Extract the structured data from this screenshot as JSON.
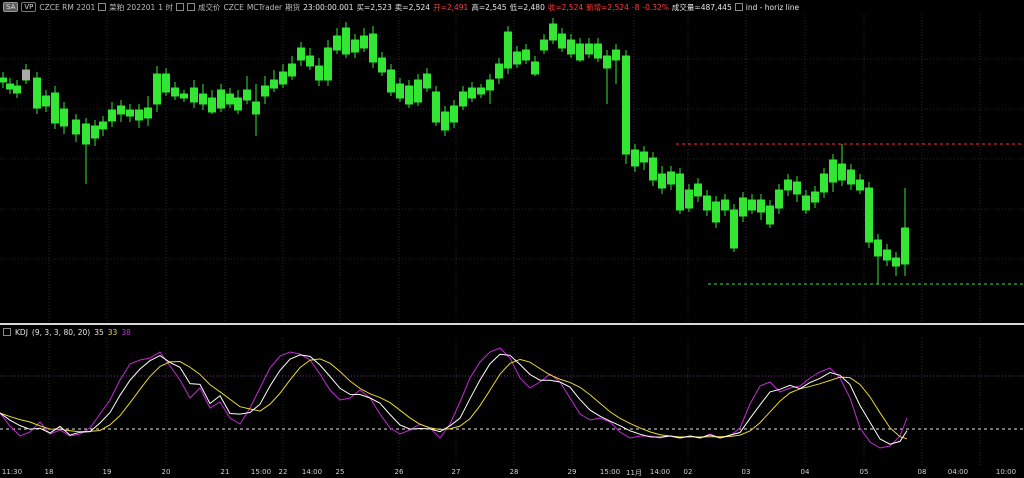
{
  "toolbar": {
    "symbol_btn": "SA",
    "vp_btn": "VP",
    "instrument": "CZCE RM 2201",
    "name": "菜粕 202201",
    "period": "1 时",
    "feed": "成交价",
    "source": "CZCE",
    "platform": "MCTrader",
    "session": "期货",
    "time": "23:00:00.001",
    "bid": "买=2,523",
    "ask": "卖=2,524",
    "open": "开=2,491",
    "high": "高=2,545",
    "low": "低=2,480",
    "last": "收=2,524",
    "change": "新增=2,524",
    "change_pts": "-8",
    "change_pct": "-0.32%",
    "volume": "成交量=487,445",
    "indicator": "ind - horiz line"
  },
  "kdj": {
    "label": "KDJ",
    "params": "(9, 3, 3, 80, 20)",
    "k_value": "35",
    "d_value": "33",
    "j_value": "38",
    "k_color": "#ffffff",
    "d_color": "#e8d92a",
    "j_color": "#c42bd6"
  },
  "colors": {
    "up": "#cc1f1f",
    "down": "#33e633",
    "resistance_line": "#ff3030",
    "support_line": "#33e633"
  },
  "x_axis_labels": [
    "11:30",
    "18",
    "19",
    "20",
    "21",
    "15:00",
    "22",
    "14:00",
    "25",
    "26",
    "27",
    "28",
    "29",
    "15:00",
    "11月",
    "14:00",
    "02",
    "03",
    "04",
    "05",
    "08",
    "04:00",
    "10:00"
  ]
}
